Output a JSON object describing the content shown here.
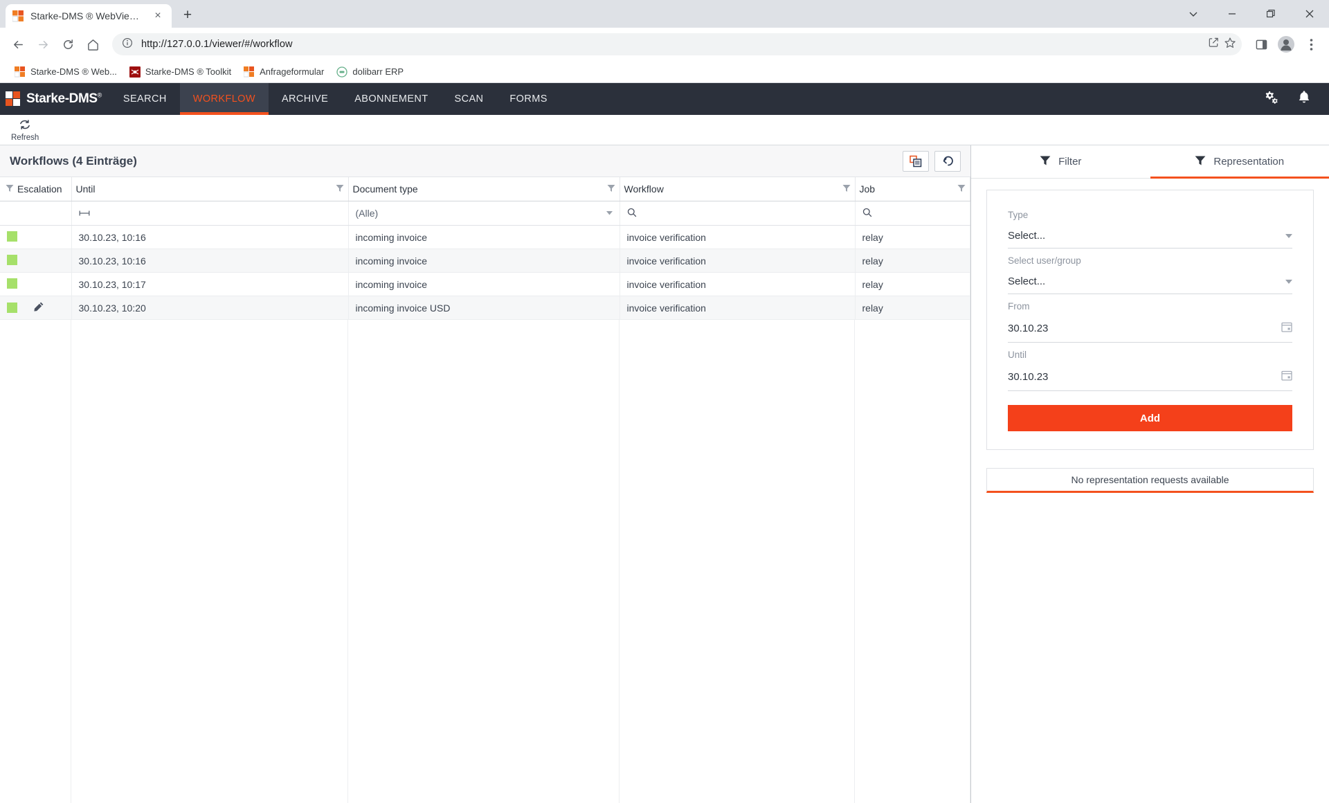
{
  "browser": {
    "tab": {
      "title": "Starke-DMS ® WebViewer",
      "favicon": "starke-dms-favicon",
      "close": "×"
    },
    "new_tab_label": "+",
    "window_controls": {
      "list": "∨",
      "minimize": "—",
      "maximize": "❐",
      "close": "✕"
    },
    "nav": {
      "back": "←",
      "forward": "→",
      "reload": "↻",
      "home": "⌂"
    },
    "omnibox": {
      "url": "http://127.0.0.1/viewer/#/workflow",
      "info_icon": "info-circle-icon",
      "share_icon": "share-icon",
      "star_icon": "star-icon"
    },
    "toolbar_right": {
      "sidepanel_icon": "side-panel-icon",
      "profile_icon": "profile-avatar-icon",
      "menu_icon": "kebab-menu-icon"
    },
    "bookmarks": [
      {
        "label": "Starke-DMS ® Web...",
        "icon": "starke-dms-favicon"
      },
      {
        "label": "Starke-DMS ® Toolkit",
        "icon": "toolkit-favicon"
      },
      {
        "label": "Anfrageformular",
        "icon": "starke-dms-favicon"
      },
      {
        "label": "dolibarr ERP",
        "icon": "dolibarr-favicon"
      }
    ]
  },
  "app": {
    "logo": {
      "text": "Starke-DMS",
      "registered": "®"
    },
    "nav": [
      {
        "label": "SEARCH",
        "active": false
      },
      {
        "label": "WORKFLOW",
        "active": true
      },
      {
        "label": "ARCHIVE",
        "active": false
      },
      {
        "label": "ABONNEMENT",
        "active": false
      },
      {
        "label": "SCAN",
        "active": false
      },
      {
        "label": "FORMS",
        "active": false
      }
    ],
    "appbar_right": {
      "settings_icon": "gears-icon",
      "notifications_icon": "bell-icon"
    },
    "subbar": {
      "refresh_label": "Refresh",
      "refresh_icon": "refresh-icon"
    }
  },
  "grid": {
    "title": "Workflows (4 Einträge)",
    "actions": {
      "duplicate_icon": "copy-icon",
      "restore_icon": "undo-icon"
    },
    "columns": [
      {
        "key": "escalation",
        "label": "Escalation",
        "filter_side": "left"
      },
      {
        "key": "until",
        "label": "Until",
        "filter_side": "right"
      },
      {
        "key": "document_type",
        "label": "Document type",
        "filter_side": "right"
      },
      {
        "key": "workflow",
        "label": "Workflow",
        "filter_side": "right"
      },
      {
        "key": "job",
        "label": "Job",
        "filter_side": "right"
      }
    ],
    "filter_row": {
      "escalation": "",
      "until": "range-filter-icon",
      "document_type": "(Alle)",
      "workflow": "search-icon",
      "job": "search-icon"
    },
    "rows": [
      {
        "escalation": "green",
        "edit": false,
        "until": "30.10.23, 10:16",
        "document_type": "incoming invoice",
        "workflow": "invoice verification",
        "job": "relay"
      },
      {
        "escalation": "green",
        "edit": false,
        "until": "30.10.23, 10:16",
        "document_type": "incoming invoice",
        "workflow": "invoice verification",
        "job": "relay"
      },
      {
        "escalation": "green",
        "edit": false,
        "until": "30.10.23, 10:17",
        "document_type": "incoming invoice",
        "workflow": "invoice verification",
        "job": "relay"
      },
      {
        "escalation": "green",
        "edit": true,
        "until": "30.10.23, 10:20",
        "document_type": "incoming invoice USD",
        "workflow": "invoice verification",
        "job": "relay"
      }
    ]
  },
  "panel": {
    "tabs": [
      {
        "label": "Filter",
        "icon": "funnel-icon",
        "active": false
      },
      {
        "label": "Representation",
        "icon": "funnel-icon",
        "active": true
      }
    ],
    "form": {
      "type_label": "Type",
      "type_value": "Select...",
      "user_group_label": "Select user/group",
      "user_group_value": "Select...",
      "from_label": "From",
      "from_value": "30.10.23",
      "until_label": "Until",
      "until_value": "30.10.23",
      "add_label": "Add"
    },
    "empty_message": "No representation requests available"
  },
  "colors": {
    "brand_orange": "#f4511e",
    "appbar_dark": "#2b303b",
    "escalation_green": "#a6e06a",
    "add_button": "#f4401a"
  }
}
